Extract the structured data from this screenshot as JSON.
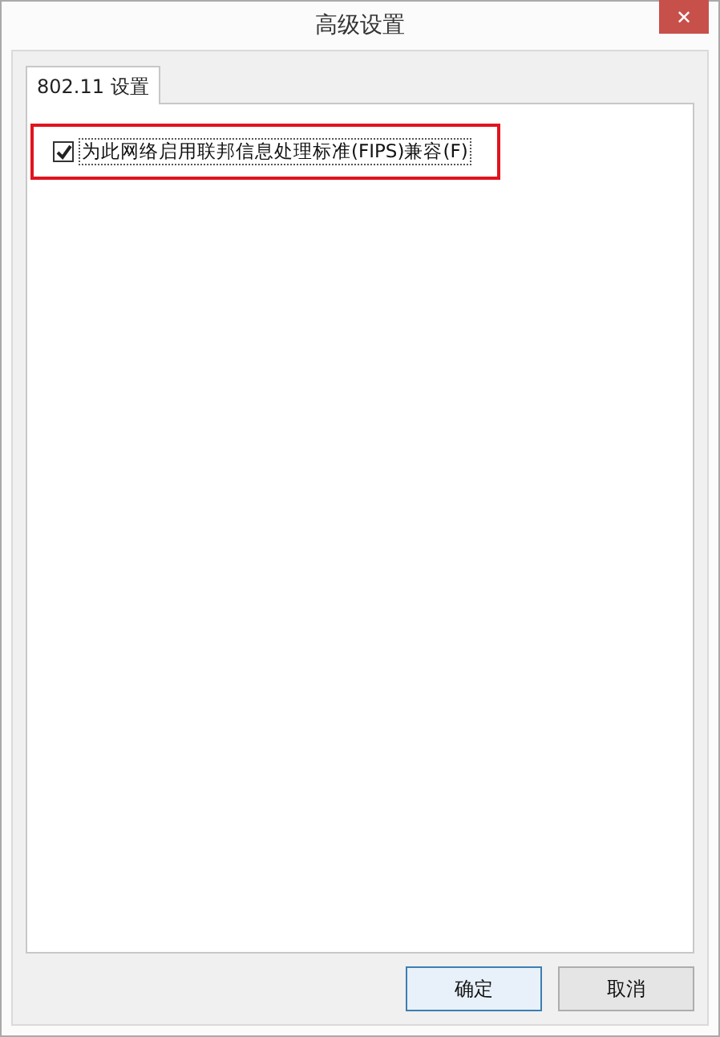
{
  "window": {
    "title": "高级设置",
    "close": "✕"
  },
  "tabs": [
    {
      "label": "802.11 设置",
      "selected": true
    }
  ],
  "options": [
    {
      "label": "为此网络启用联邦信息处理标准(FIPS)兼容(F)",
      "checked": true,
      "highlighted": true
    }
  ],
  "buttons": [
    {
      "label": "确定",
      "default": true
    },
    {
      "label": "取消",
      "default": false
    }
  ]
}
